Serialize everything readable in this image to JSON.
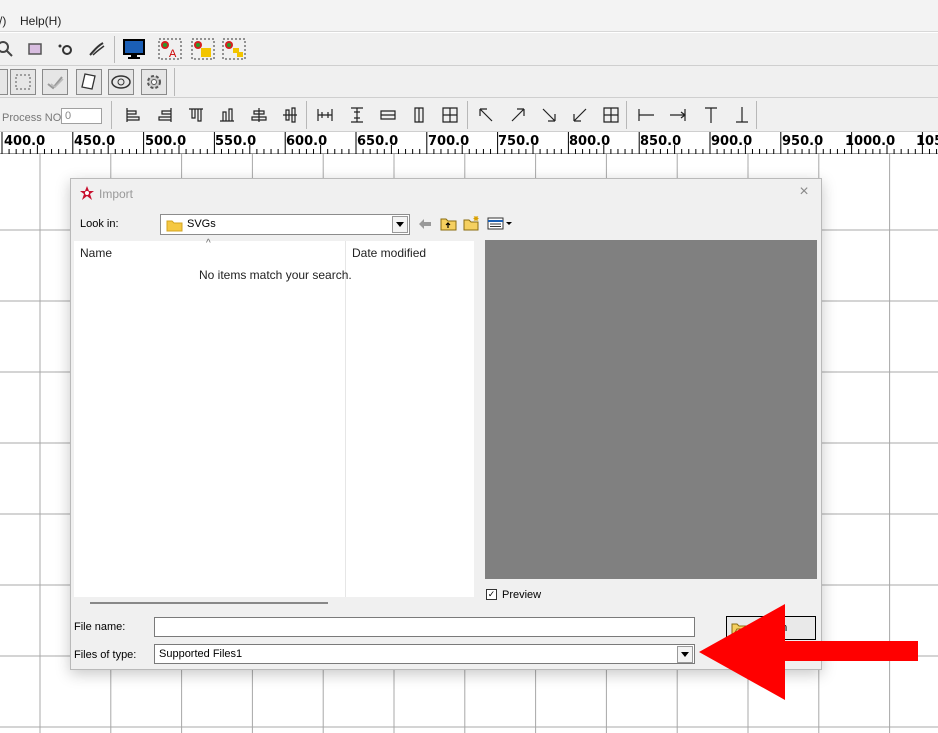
{
  "menu": {
    "partial_item": "/)",
    "help": "Help(H)"
  },
  "toolbar": {
    "process_label": "Process NO:",
    "process_value": "0"
  },
  "ruler": {
    "labels": [
      "400.0",
      "450.0",
      "500.0",
      "550.0",
      "600.0",
      "650.0",
      "700.0",
      "750.0",
      "800.0",
      "850.0",
      "900.0",
      "950.0",
      "1000.0",
      "105"
    ]
  },
  "dialog": {
    "title": "Import",
    "close": "×",
    "look_in_label": "Look in:",
    "look_in_value": "SVGs",
    "columns": {
      "name": "Name",
      "date": "Date modified"
    },
    "empty_message": "No items match your search.",
    "preview_label": "Preview",
    "preview_checked": true,
    "file_name_label": "File name:",
    "file_name_value": "",
    "files_of_type_label": "Files of type:",
    "files_of_type_value": "Supported Files1",
    "open_button": "Open",
    "open_button_visible": "en"
  },
  "colors": {
    "preview_bg": "#808080",
    "annotation_arrow": "#ff0000"
  }
}
